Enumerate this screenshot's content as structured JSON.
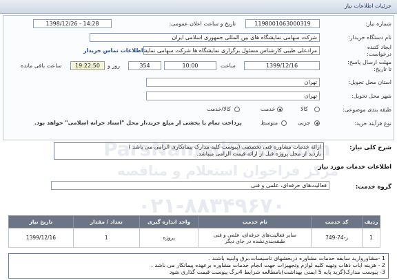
{
  "header": {
    "title": "جزئیات اطلاعات نیاز"
  },
  "fields": {
    "need_number_label": "شماره نیاز:",
    "need_number": "1198001063000319",
    "announce_label": "تاریخ و ساعت اعلان عمومی:",
    "announce_value": "1398/12/26 - 14:28",
    "buyer_label": "نام دستگاه خریدار:",
    "buyer_value": "شرکت سهامی نمایشگاه های بین المللی جمهوری اسلامی ایران",
    "requester_label": "ایجاد کننده درخواست:",
    "requester_value": "مرادعلی طیبی کارشناس مسئول برگزاری نمایشگاه ها شرکت سهامی نمایشگ",
    "contact_link": "اطلاعات تماس خریدار",
    "deadline_label": "مهلت ارسال پاسخ: تا تاریخ:",
    "deadline_date": "1399/12/16",
    "time_label": "ساعت",
    "deadline_time": "10:00",
    "days_value": "354",
    "days_label": "روز و",
    "remaining_value": "19:22:50",
    "remaining_label": "ساعت باقی مانده",
    "province_label": "استان محل تحویل:",
    "province_value": "تهران",
    "city_label": "شهر محل تحویل:",
    "city_value": "تهران",
    "category_label": "طبقه بندی موضوعی:",
    "category_options": [
      "کالا",
      "خدمت",
      "کالا/خدمت"
    ],
    "category_selected": "خدمت",
    "payment_label": "نوع فرآیند خرید:",
    "payment_options": [
      "جزیی",
      "متوسط"
    ],
    "payment_selected": "جزیی",
    "payment_note": "پرداخت تمام یا بخشی از مبلغ خرید،از محل \"اسناد خزانه اسلامی\" خواهد بود."
  },
  "summary": {
    "label": "شرح کلی نیاز:",
    "line1": "ارائه خدمات  مشاوره فنی تخصصی (پیوست کلیه مدارک پیمانکاری الزامی می باشد )",
    "line2": "بازدید از محل پروژه قبل از ارائه قیمت الزامی میباشد."
  },
  "services_header": "اطلاعات خدمات مورد نیاز",
  "group": {
    "label": "گروه خدمت:",
    "value": "فعالیت‌های حرفه‌ای، علمی و فنی"
  },
  "table": {
    "headers": [
      "ردیف",
      "کد خدمت",
      "نام خدمت",
      "واحد اندازه گیری",
      "تعداد / مقدار",
      "تاریخ نیاز"
    ],
    "rows": [
      [
        "1",
        "ز-74-749",
        "سایر فعالیت‌های حرفه‌ای، علمی و فنی طبقه‌بندی‌نشده در جای دیگر",
        "پروژه",
        "1",
        "1399/12/16"
      ]
    ]
  },
  "notes": {
    "lines": [
      "1 -مشاوروارید سابقه خدمات مشاوره دربخشهای تاسیسات،برق وابنیه باشند .",
      "2 - هزینه ایاب ذهاب وتهیه کلیه لوازم وتجهیزات جهت انجام خدمات مشاوره برعهده پیمانکار می باشد .",
      "3- پیوست مدارک(گرید پایه 5 ایمنی بهداشت)بامطالعه شرایط 4برگ پیوست قیمت گذاری شود"
    ]
  },
  "watermark": {
    "line1": "ParsNamadData.com",
    "line2": "مرکز فراخوان استعلام و مناقصه",
    "line3": "۰۲۱-۸۸۳۴۹۶۷۰"
  }
}
